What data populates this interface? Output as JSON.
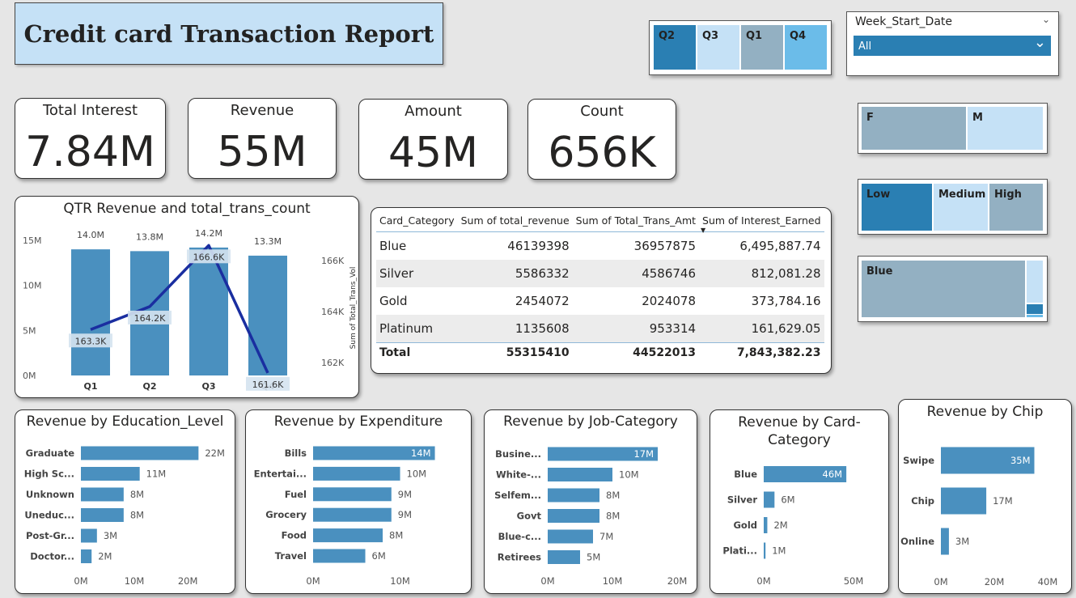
{
  "report_title": "Credit card Transaction Report",
  "quarter_slicer": {
    "items": [
      {
        "label": "Q2",
        "color": "#2a7fb3"
      },
      {
        "label": "Q3",
        "color": "#c5e1f6"
      },
      {
        "label": "Q1",
        "color": "#93b0c2"
      },
      {
        "label": "Q4",
        "color": "#6bbce9"
      }
    ]
  },
  "week_slicer": {
    "title": "Week_Start_Date",
    "selected": "All"
  },
  "gender_slicer": {
    "items": [
      {
        "label": "F",
        "color": "#93b0c2"
      },
      {
        "label": "M",
        "color": "#c5e1f6"
      }
    ]
  },
  "income_slicer": {
    "items": [
      {
        "label": "Low",
        "color": "#2a7fb3"
      },
      {
        "label": "Medium",
        "color": "#c5e1f6"
      },
      {
        "label": "High",
        "color": "#93b0c2"
      }
    ]
  },
  "card_slicer": {
    "items": [
      {
        "label": "Blue",
        "color": "#93b0c2"
      }
    ]
  },
  "kpis": [
    {
      "label": "Total Interest",
      "value": "7.84M"
    },
    {
      "label": "Revenue",
      "value": "55M"
    },
    {
      "label": "Amount",
      "value": "45M"
    },
    {
      "label": "Count",
      "value": "656K"
    }
  ],
  "table": {
    "headers": [
      "Card_Category",
      "Sum of total_revenue",
      "Sum of Total_Trans_Amt",
      "Sum of Interest_Earned"
    ],
    "rows": [
      [
        "Blue",
        "46139398",
        "36957875",
        "6,495,887.74"
      ],
      [
        "Silver",
        "5586332",
        "4586746",
        "812,081.28"
      ],
      [
        "Gold",
        "2454072",
        "2024078",
        "373,784.16"
      ],
      [
        "Platinum",
        "1135608",
        "953314",
        "161,629.05"
      ]
    ],
    "total": [
      "Total",
      "55315410",
      "44522013",
      "7,843,382.23"
    ]
  },
  "chart_data": [
    {
      "type": "bar",
      "id": "qtr",
      "title": "QTR Revenue and total_trans_count",
      "categories": [
        "Q1",
        "Q2",
        "Q3",
        "Q4"
      ],
      "series": [
        {
          "values": [
            14.0,
            13.8,
            14.2,
            13.3
          ],
          "labels": [
            "14.0M",
            "13.8M",
            "14.2M",
            "13.3M"
          ],
          "color": "#4a90bf"
        },
        {
          "values": [
            163.3,
            164.2,
            166.6,
            161.6
          ],
          "labels": [
            "163.3K",
            "164.2K",
            "166.6K",
            "161.6K"
          ],
          "color": "#1a2ea0"
        }
      ],
      "ylim": [
        0,
        15
      ],
      "yticks": [
        "0M",
        "5M",
        "10M",
        "15M"
      ],
      "y2lim": [
        161.5,
        166.8
      ],
      "y2ticks": [
        162,
        164,
        166
      ],
      "y2tick_labels": [
        "162K",
        "164K",
        "166K"
      ],
      "y2label": "Sum of Total_Trans_Vol"
    },
    {
      "type": "bar",
      "id": "edu",
      "orientation": "horizontal",
      "title": "Revenue by Education_Level",
      "categories": [
        "Graduate",
        "High Sc...",
        "Unknown",
        "Uneduc...",
        "Post-Gr...",
        "Doctor..."
      ],
      "values": [
        22,
        11,
        8,
        8,
        3,
        2
      ],
      "labels": [
        "22M",
        "11M",
        "8M",
        "8M",
        "3M",
        "2M"
      ],
      "xlim": [
        0,
        28
      ],
      "xticks": [
        0,
        10,
        20
      ],
      "xtick_labels": [
        "0M",
        "10M",
        "20M"
      ],
      "color": "#4a90bf"
    },
    {
      "type": "bar",
      "id": "exp",
      "orientation": "horizontal",
      "title": "Revenue by Expenditure",
      "categories": [
        "Bills",
        "Entertai...",
        "Fuel",
        "Grocery",
        "Food",
        "Travel"
      ],
      "values": [
        14,
        10,
        9,
        9,
        8,
        6
      ],
      "labels": [
        "14M",
        "10M",
        "9M",
        "9M",
        "8M",
        "6M"
      ],
      "xlim": [
        0,
        14.6
      ],
      "xticks": [
        0,
        10
      ],
      "xtick_labels": [
        "0M",
        "10M"
      ],
      "color": "#4a90bf"
    },
    {
      "type": "bar",
      "id": "job",
      "orientation": "horizontal",
      "title": "Revenue by Job-Category",
      "categories": [
        "Busine...",
        "White-...",
        "Selfem...",
        "Govt",
        "Blue-c...",
        "Retirees"
      ],
      "values": [
        17,
        10,
        8,
        8,
        7,
        5
      ],
      "labels": [
        "17M",
        "10M",
        "8M",
        "8M",
        "7M",
        "5M"
      ],
      "xlim": [
        0,
        20
      ],
      "xticks": [
        0,
        10,
        20
      ],
      "xtick_labels": [
        "0M",
        "10M",
        "20M"
      ],
      "color": "#4a90bf"
    },
    {
      "type": "bar",
      "id": "card",
      "orientation": "horizontal",
      "title": "Revenue by Card-Category",
      "categories": [
        "Blue",
        "Silver",
        "Gold",
        "Plati..."
      ],
      "values": [
        46,
        6,
        2,
        1
      ],
      "labels": [
        "46M",
        "6M",
        "2M",
        "1M"
      ],
      "xlim": [
        0,
        50
      ],
      "xticks": [
        0,
        50
      ],
      "xtick_labels": [
        "0M",
        "50M"
      ],
      "color": "#4a90bf"
    },
    {
      "type": "bar",
      "id": "chip",
      "orientation": "horizontal",
      "title": "Revenue by Chip",
      "categories": [
        "Swipe",
        "Chip",
        "Online"
      ],
      "values": [
        35,
        17,
        3
      ],
      "labels": [
        "35M",
        "17M",
        "3M"
      ],
      "xlim": [
        0,
        40
      ],
      "xticks": [
        0,
        20,
        40
      ],
      "xtick_labels": [
        "0M",
        "20M",
        "40M"
      ],
      "color": "#4a90bf"
    }
  ]
}
